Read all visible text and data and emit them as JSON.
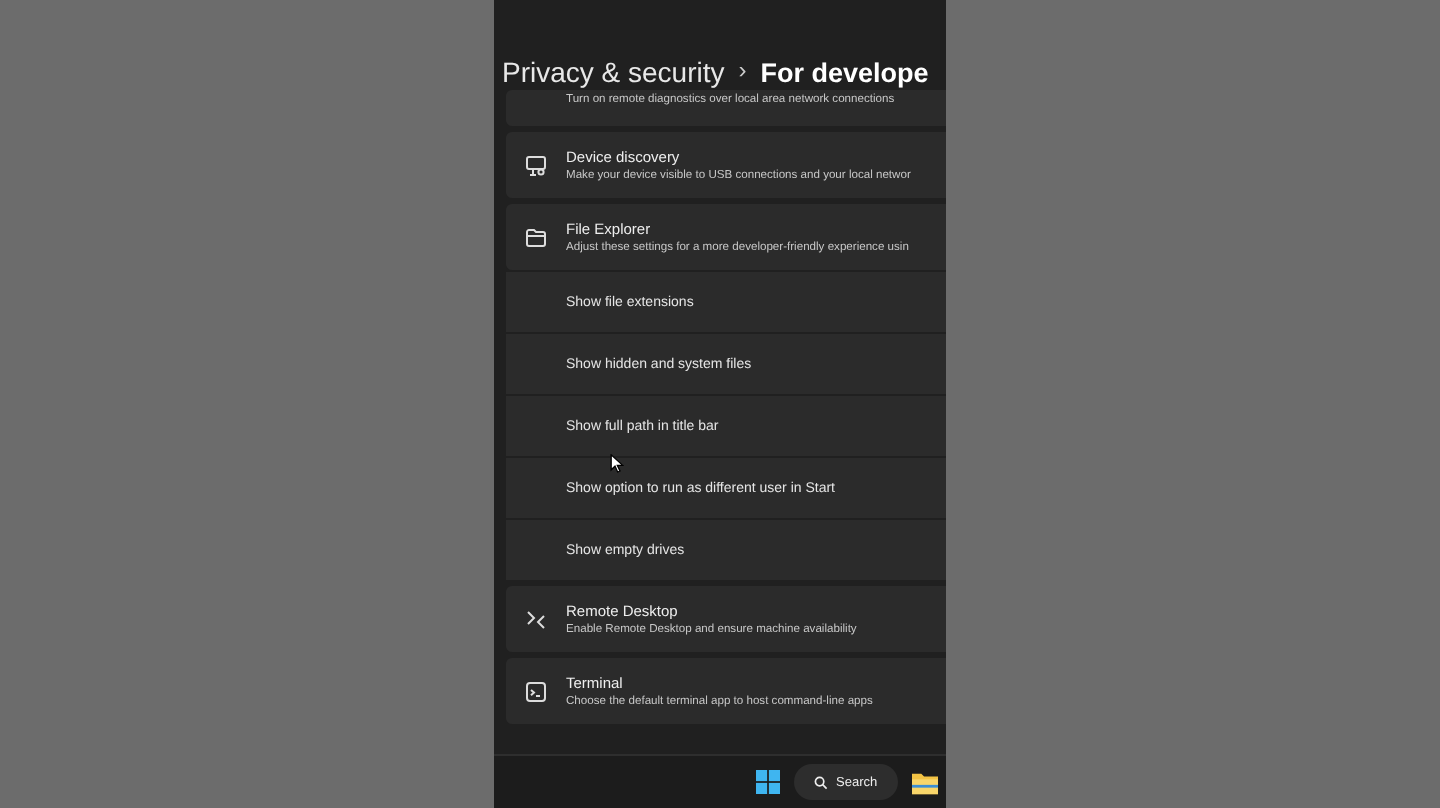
{
  "breadcrumb": {
    "parent": "Privacy & security",
    "separator": "›",
    "current": "For develope"
  },
  "settings": [
    {
      "kind": "card-partial",
      "description": "Turn on remote diagnostics over local area network connections"
    },
    {
      "kind": "card",
      "title": "Device discovery",
      "description": "Make your device visible to USB connections and your local networ"
    },
    {
      "kind": "card",
      "title": "File Explorer",
      "description": "Adjust these settings for a more developer-friendly experience usin"
    },
    {
      "kind": "subrow",
      "title": "Show file extensions"
    },
    {
      "kind": "subrow",
      "title": "Show hidden and system files"
    },
    {
      "kind": "subrow",
      "title": "Show full path in title bar"
    },
    {
      "kind": "subrow",
      "title": "Show option to run as different user in Start"
    },
    {
      "kind": "subrow",
      "title": "Show empty drives"
    },
    {
      "kind": "card",
      "title": "Remote Desktop",
      "description": "Enable Remote Desktop and ensure machine availability"
    },
    {
      "kind": "card",
      "title": "Terminal",
      "description": "Choose the default terminal app to host command-line apps"
    }
  ],
  "taskbar": {
    "search": "Search"
  }
}
